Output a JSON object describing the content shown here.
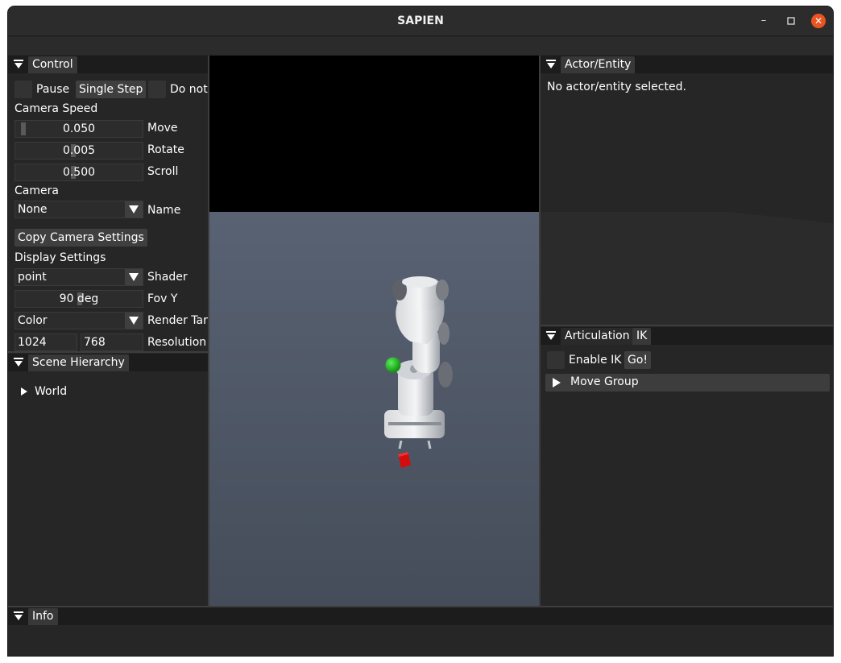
{
  "window": {
    "title": "SAPIEN"
  },
  "control": {
    "tab": "Control",
    "pause_label": "Pause",
    "single_step_label": "Single Step",
    "do_not_label": "Do not",
    "camera_speed_label": "Camera Speed",
    "move_value": "0.050",
    "move_label": "Move",
    "rotate_value": "0.005",
    "rotate_label": "Rotate",
    "scroll_value": "0.500",
    "scroll_label": "Scroll",
    "camera_label": "Camera",
    "camera_selected": "None",
    "name_label": "Name",
    "copy_camera_label": "Copy Camera Settings",
    "display_settings_label": "Display Settings",
    "shader_selected": "point",
    "shader_label": "Shader",
    "fov_value": "90 deg",
    "fov_label": "Fov Y",
    "render_target_selected": "Color",
    "render_target_label": "Render Tar",
    "resolution_width": "1024",
    "resolution_height": "768",
    "resolution_label": "Resolution"
  },
  "scene_hierarchy": {
    "tab": "Scene Hierarchy",
    "root": "World"
  },
  "actor_entity": {
    "tab": "Actor/Entity",
    "message": "No actor/entity selected."
  },
  "articulation": {
    "tab": "Articulation",
    "ik_tab": "IK",
    "enable_ik_label": "Enable IK",
    "go_label": "Go!",
    "move_group_label": "Move Group"
  },
  "info": {
    "tab": "Info"
  },
  "colors": {
    "accent_close": "#e95420",
    "viewport_floor": "#4c5563",
    "target_marker": "#1fae1f",
    "cube": "#d40c0c"
  },
  "icons": [
    "collapse-arrow-icon",
    "minimize-icon",
    "maximize-icon",
    "close-icon",
    "chevron-down-icon",
    "tree-expand-icon"
  ]
}
